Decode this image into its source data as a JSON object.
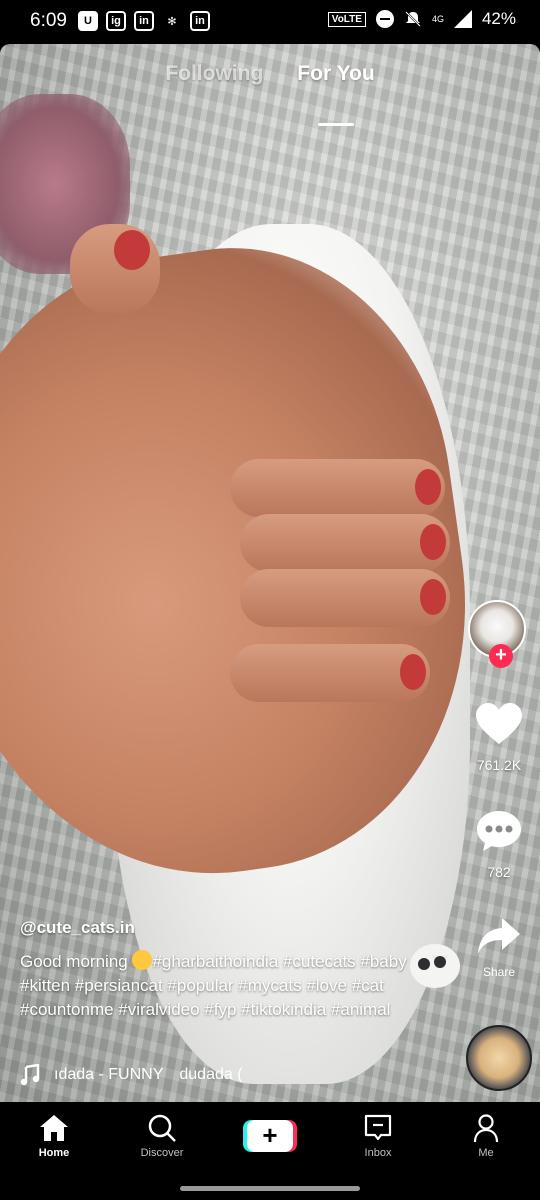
{
  "status_bar": {
    "time": "6:09",
    "app_icons": [
      "U",
      "ig",
      "in",
      "✻",
      "in"
    ],
    "volte": "VoLTE",
    "network": "4G",
    "battery": "42%"
  },
  "top_tabs": [
    {
      "label": "Following",
      "active": false
    },
    {
      "label": "For You",
      "active": true
    }
  ],
  "right_rail": {
    "follow_plus": "+",
    "likes": "761.2K",
    "comments": "782",
    "share_label": "Share"
  },
  "caption": {
    "username": "@cute_cats.in",
    "description_prefix": "Good morning ",
    "emoji": "heart-eyes-emoji",
    "description_tags_line1": "#gharbaithoindia",
    "description_rest": "#cutecats #baby #kitten #persiancat #popular #mycats #love #cat #countonme #viralvideo #fyp #tiktokindia #animal"
  },
  "music": {
    "track_part1": "ıdada - FUNNY",
    "track_part2": "dudada ("
  },
  "bottom_nav": [
    {
      "label": "Home",
      "icon": "home-icon",
      "active": true
    },
    {
      "label": "Discover",
      "icon": "search-icon",
      "active": false
    },
    {
      "label": "+",
      "icon": "create-icon",
      "active": false
    },
    {
      "label": "Inbox",
      "icon": "inbox-icon",
      "active": false
    },
    {
      "label": "Me",
      "icon": "profile-icon",
      "active": false
    }
  ],
  "colors": {
    "accent_red": "#fe2c55",
    "accent_cyan": "#25f4ee",
    "background": "#000000"
  }
}
